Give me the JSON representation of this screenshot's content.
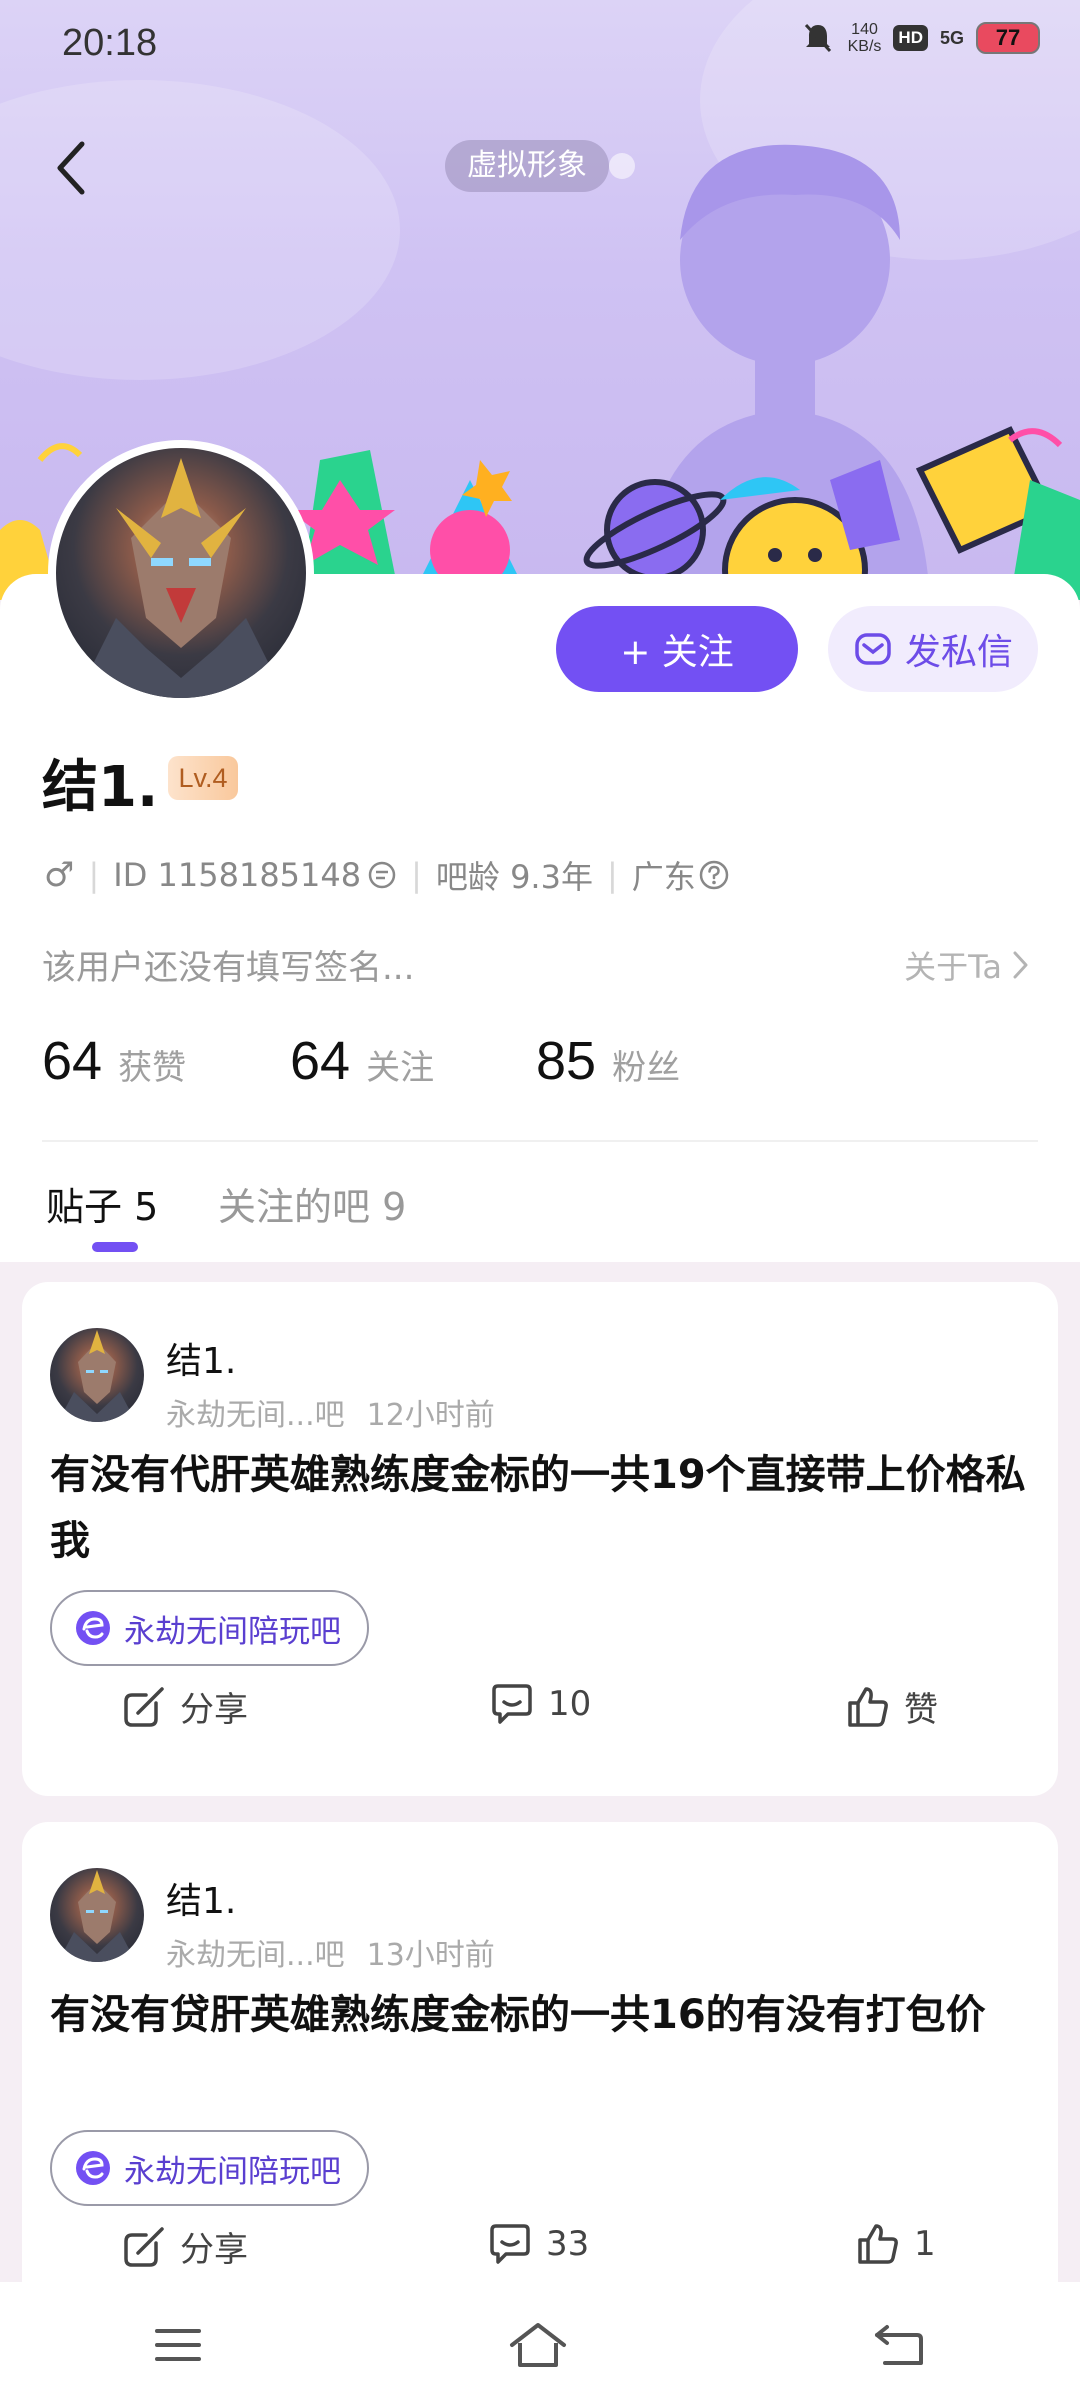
{
  "status_bar": {
    "time": "20:18",
    "net_speed_top": "140",
    "net_speed_bottom": "KB/s",
    "hd": "HD",
    "signal": "5G",
    "battery": "77"
  },
  "banner": {
    "avatar_tag": "虚拟形象"
  },
  "profile": {
    "follow_label": "+ 关注",
    "message_label": "发私信",
    "username": "结1.",
    "level": "Lv.4",
    "gender_symbol": "♂",
    "id_text": "ID 1158185148",
    "age_text": "吧龄 9.3年",
    "location": "广东",
    "signature": "该用户还没有填写签名...",
    "about_label": "关于Ta",
    "stats": [
      {
        "num": "64",
        "label": "获赞"
      },
      {
        "num": "64",
        "label": "关注"
      },
      {
        "num": "85",
        "label": "粉丝"
      }
    ]
  },
  "tabs": [
    {
      "label": "贴子 5"
    },
    {
      "label": "关注的吧 9"
    }
  ],
  "posts": [
    {
      "author": "结1.",
      "forum_short": "永劫无间...吧",
      "time": "12小时前",
      "title": "有没有代肝英雄熟练度金标的一共19个直接带上价格私我",
      "forum_tag": "永劫无间陪玩吧",
      "share_label": "分享",
      "comments": "10",
      "like_label": "赞"
    },
    {
      "author": "结1.",
      "forum_short": "永劫无间...吧",
      "time": "13小时前",
      "title": "有没有贷肝英雄熟练度金标的一共16的有没有打包价",
      "forum_tag": "永劫无间陪玩吧",
      "share_label": "分享",
      "comments": "33",
      "like_label": "1"
    }
  ],
  "colors": {
    "accent": "#7350f3",
    "banner": "#cfc2f3",
    "level_text": "#b05d20"
  }
}
